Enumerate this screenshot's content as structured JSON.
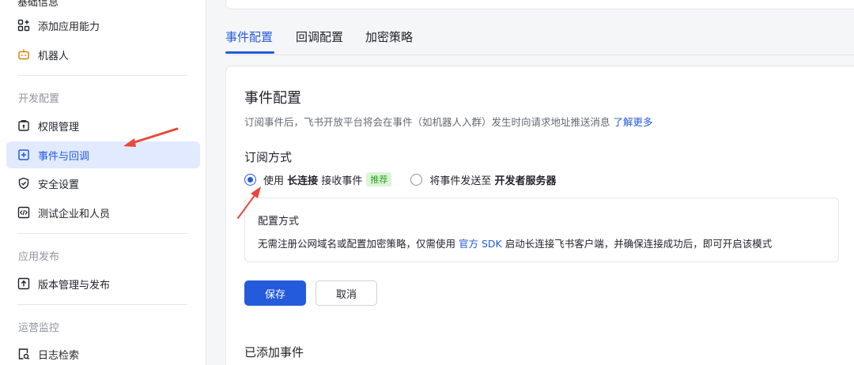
{
  "sidebar": {
    "top_partial": "基础信息",
    "items": [
      {
        "label": "添加应用能力",
        "icon": "apps-add-icon"
      },
      {
        "label": "机器人",
        "icon": "robot-icon"
      },
      {
        "label": "权限管理",
        "icon": "permission-icon"
      },
      {
        "label": "事件与回调",
        "icon": "event-callback-icon",
        "active": true
      },
      {
        "label": "安全设置",
        "icon": "shield-icon"
      },
      {
        "label": "测试企业和人员",
        "icon": "code-test-icon"
      },
      {
        "label": "版本管理与发布",
        "icon": "upload-icon"
      },
      {
        "label": "日志检索",
        "icon": "log-search-icon"
      }
    ],
    "sections": {
      "dev": "开发配置",
      "publish": "应用发布",
      "ops": "运营监控"
    }
  },
  "tabs": [
    {
      "label": "事件配置",
      "active": true
    },
    {
      "label": "回调配置"
    },
    {
      "label": "加密策略"
    }
  ],
  "panel": {
    "title": "事件配置",
    "desc": "订阅事件后，飞书开放平台将会在事件（如机器人入群）发生时向请求地址推送消息",
    "learn_more": "了解更多",
    "subscribe_title": "订阅方式",
    "option1": {
      "prefix": "使用",
      "bold": "长连接",
      "suffix": "接收事件",
      "tag": "推荐",
      "selected": true
    },
    "option2": {
      "prefix": "将事件发送至",
      "bold": "开发者服务器",
      "selected": false
    },
    "info_title": "配置方式",
    "info_text_1": "无需注册公网域名或配置加密策略，仅需使用",
    "info_link": "官方 SDK",
    "info_text_2": "启动长连接飞书客户端，并确保连接成功后，即可开启该模式",
    "save": "保存",
    "cancel": "取消",
    "added_events": "已添加事件"
  },
  "colors": {
    "accent": "#245bdb",
    "active_bg": "#e1eaff",
    "tag_bg": "#d9f5d6",
    "tag_text": "#2ea121",
    "annotation_arrow": "#e8473b"
  }
}
